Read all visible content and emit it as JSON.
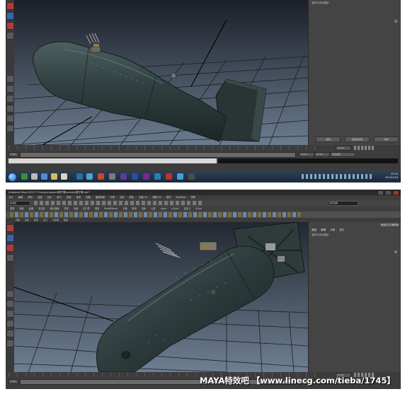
{
  "shot1": {
    "panel": {
      "title": "没什么可以显示",
      "buttons": [
        "应用",
        "应用并关闭",
        "关闭"
      ]
    },
    "timeline": {
      "end_value": "24.00",
      "range_start": "1.00",
      "range_end": "24.00",
      "anim_end": "48.00",
      "range_label": "无动画层"
    },
    "taskbar": {
      "time": "23:34",
      "date": "2015/1/16"
    }
  },
  "shot2": {
    "titlebar": {
      "title": "Autodesk Maya 2015 ? H:\\maya project\\原子弹\\scenes\\原子弹.mb*"
    },
    "menubar": {
      "items": [
        "文件",
        "编辑",
        "修改",
        "创建",
        "显示",
        "窗口",
        "资源",
        "选择",
        "网格",
        "编辑网格",
        "代理",
        "法线",
        "颜色",
        "创建 UV",
        "编辑 UV",
        "肌肉",
        "Realflow",
        "帮助"
      ]
    },
    "status": {
      "mode": "多边形",
      "search": "没有选择"
    },
    "shelf_tabs": [
      "常规",
      "曲线",
      "曲面",
      "多边形",
      "细分曲面",
      "变形",
      "动画",
      "动力学",
      "渲染",
      "PaintEffects",
      "卡通",
      "肌肉",
      "流体",
      "头发",
      "nHair",
      "nCloth",
      "自定义",
      "XGen"
    ],
    "panel_menu": [
      "视图",
      "着色",
      "照明",
      "显示",
      "渲染器",
      "面板"
    ],
    "panel": {
      "header": "通道盒/层编辑器",
      "tabs": [
        "通道",
        "编辑",
        "对象",
        "显示"
      ],
      "title": "没什么可以显示"
    },
    "timeline": {
      "end_value": "24.00",
      "range_start": "1.00",
      "range_end": "24.00",
      "anim_end": "48.00",
      "range_label": "无动画层"
    }
  },
  "watermark": {
    "text": "MAYA特效吧 【www.linecg.com/tieba/1745】"
  },
  "colors": {
    "viewport_top": "#1b1f27",
    "viewport_bottom": "#6b7c90",
    "grid": "#1e1e1e",
    "bomb_body": "#2f3f3f",
    "panel_bg": "#444444"
  }
}
